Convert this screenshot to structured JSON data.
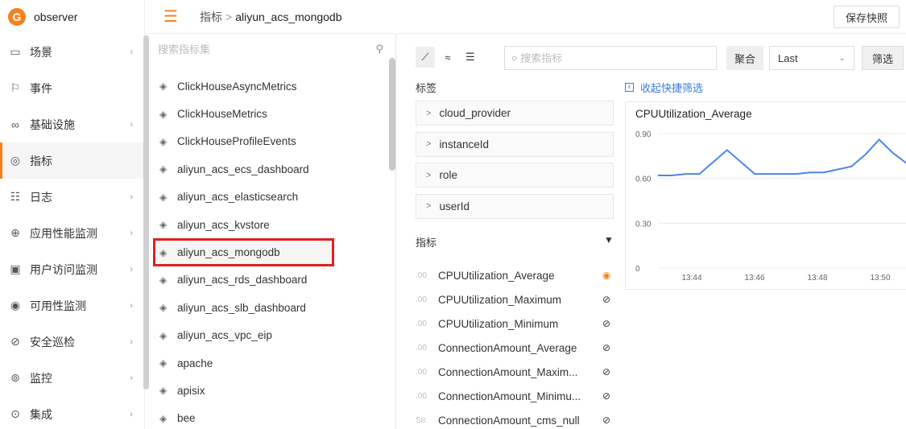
{
  "app": {
    "name": "observer"
  },
  "topbar": {
    "breadcrumb_parent": "指标",
    "breadcrumb_sep": ">",
    "breadcrumb_current": "aliyun_acs_mongodb",
    "save_label": "保存快照"
  },
  "nav": {
    "items": [
      {
        "label": "场景",
        "icon": "scene-icon",
        "chevron": true
      },
      {
        "label": "事件",
        "icon": "flag-icon",
        "chevron": false
      },
      {
        "label": "基础设施",
        "icon": "infrastructure-icon",
        "chevron": true
      },
      {
        "label": "指标",
        "icon": "metrics-icon",
        "chevron": false,
        "active": true
      },
      {
        "label": "日志",
        "icon": "log-icon",
        "chevron": true
      },
      {
        "label": "应用性能监测",
        "icon": "apm-icon",
        "chevron": true
      },
      {
        "label": "用户访问监测",
        "icon": "rum-icon",
        "chevron": true
      },
      {
        "label": "可用性监测",
        "icon": "dial-test-icon",
        "chevron": true
      },
      {
        "label": "安全巡检",
        "icon": "shield-icon",
        "chevron": true
      },
      {
        "label": "监控",
        "icon": "monitor-icon",
        "chevron": true
      },
      {
        "label": "集成",
        "icon": "integration-icon",
        "chevron": true
      }
    ]
  },
  "metric_sets": {
    "search_placeholder": "搜索指标集",
    "items": [
      "ClickHouseAsyncMetrics",
      "ClickHouseMetrics",
      "ClickHouseProfileEvents",
      "aliyun_acs_ecs_dashboard",
      "aliyun_acs_elasticsearch",
      "aliyun_acs_kvstore",
      "aliyun_acs_mongodb",
      "aliyun_acs_rds_dashboard",
      "aliyun_acs_slb_dashboard",
      "aliyun_acs_vpc_eip",
      "apache",
      "apisix",
      "bee"
    ],
    "selected": "aliyun_acs_mongodb"
  },
  "toolbar": {
    "search_placeholder": "搜索指标",
    "agg_label": "聚合",
    "agg_value": "Last",
    "filter_label": "筛选"
  },
  "tags": {
    "title": "标签",
    "collapse_label": "收起快捷筛选",
    "items": [
      "cloud_provider",
      "instanceId",
      "role",
      "userId"
    ]
  },
  "metrics": {
    "title": "指标",
    "items": [
      {
        "type": ".00",
        "name": "CPUUtilization_Average",
        "visible": true
      },
      {
        "type": ".00",
        "name": "CPUUtilization_Maximum",
        "visible": false
      },
      {
        "type": ".00",
        "name": "CPUUtilization_Minimum",
        "visible": false
      },
      {
        "type": ".00",
        "name": "ConnectionAmount_Average",
        "visible": false
      },
      {
        "type": ".00",
        "name": "ConnectionAmount_Maxim...",
        "visible": false
      },
      {
        "type": ".00",
        "name": "ConnectionAmount_Minimu...",
        "visible": false
      },
      {
        "type": "Str.",
        "name": "ConnectionAmount_cms_null",
        "visible": false
      }
    ]
  },
  "chart_data": {
    "type": "line",
    "title": "CPUUtilization_Average",
    "x_ticks": [
      "13:44",
      "13:46",
      "13:48",
      "13:50"
    ],
    "y_ticks": [
      "0",
      "0.30",
      "0.60",
      "0.90"
    ],
    "ylim": [
      0,
      0.9
    ],
    "grid": true,
    "color": "#4a86e8",
    "series": [
      {
        "values": [
          0.62,
          0.62,
          0.63,
          0.63,
          0.71,
          0.79,
          0.71,
          0.63,
          0.63,
          0.63,
          0.63,
          0.64,
          0.64,
          0.66,
          0.68,
          0.76,
          0.86,
          0.77,
          0.7
        ]
      }
    ]
  }
}
